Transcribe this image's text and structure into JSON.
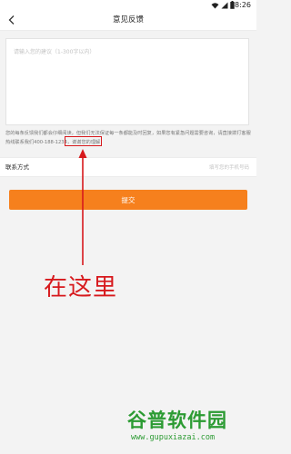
{
  "status_bar": {
    "time": "8:26",
    "icons": [
      "wifi-icon",
      "signal-icon",
      "battery-icon"
    ]
  },
  "navbar": {
    "title": "意见反馈",
    "back_icon": "chevron-left-icon"
  },
  "feedback": {
    "placeholder": "请输入您的建议（1-300字以内）"
  },
  "notice": {
    "text_before": "您的每条反馈我们都会仔细阅读，但我们无法保证每一条都能及时回复，如果您有紧急问题需要咨询，请直接拨打客服热线联系我们",
    "phone": "400-188-1234",
    "text_after": "谢谢您的理解"
  },
  "contact": {
    "label": "联系方式",
    "placeholder": "填写您的手机号码"
  },
  "submit": {
    "label": "提交"
  },
  "annotation": {
    "text": "在这里",
    "color": "#d7191d"
  },
  "watermark": {
    "logo": "谷普软件园",
    "url": "www.gupuxiazai.com",
    "color": "#2c9b33"
  },
  "colors": {
    "accent": "#f6801d",
    "background": "#f3f3f3"
  }
}
